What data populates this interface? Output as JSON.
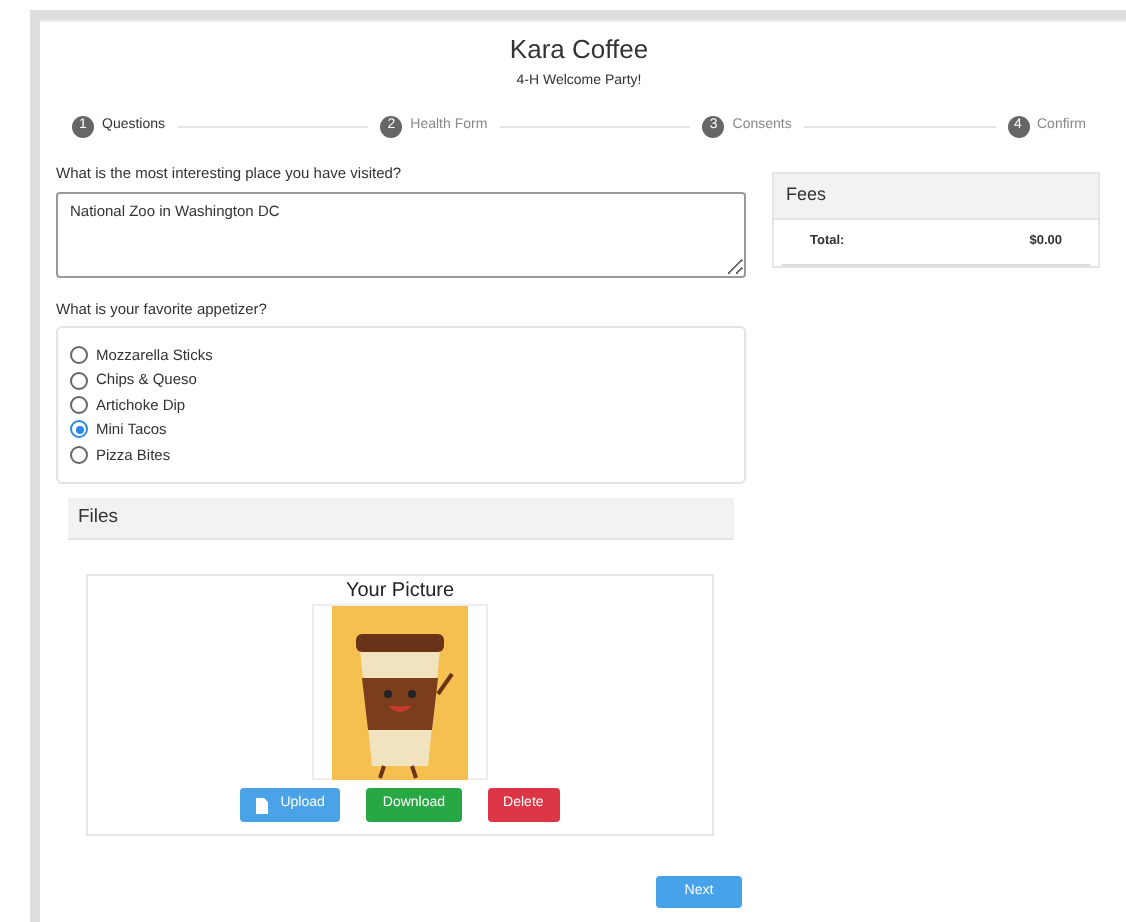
{
  "header": {
    "title": "Kara Coffee",
    "subtitle": "4-H Welcome Party!"
  },
  "steps": [
    {
      "number": "1",
      "label": "Questions",
      "selected": true
    },
    {
      "number": "2",
      "label": "Health Form",
      "selected": false
    },
    {
      "number": "3",
      "label": "Consents",
      "selected": false
    },
    {
      "number": "4",
      "label": "Confirm",
      "selected": false
    }
  ],
  "questions": [
    {
      "kind": "text",
      "label": "What is the most interesting place you have visited?",
      "value": "National Zoo in Washington DC"
    },
    {
      "kind": "radio",
      "label": "What is your favorite appetizer?",
      "options": [
        {
          "label": "Mozzarella Sticks",
          "selected": false
        },
        {
          "label": "Chips & Queso",
          "selected": false
        },
        {
          "label": "Artichoke Dip",
          "selected": false
        },
        {
          "label": "Mini Tacos",
          "selected": true
        },
        {
          "label": "Pizza Bites",
          "selected": false
        }
      ]
    }
  ],
  "files": {
    "heading": "Files",
    "picture_title": "Your Picture",
    "buttons": [
      {
        "kind": "upload",
        "label": "Upload"
      },
      {
        "kind": "download",
        "label": "Download"
      },
      {
        "kind": "delete",
        "label": "Delete"
      }
    ]
  },
  "next_button": "Next",
  "fees": {
    "heading": "Fees",
    "total_label": "Total:",
    "total_value": "$0.00"
  }
}
